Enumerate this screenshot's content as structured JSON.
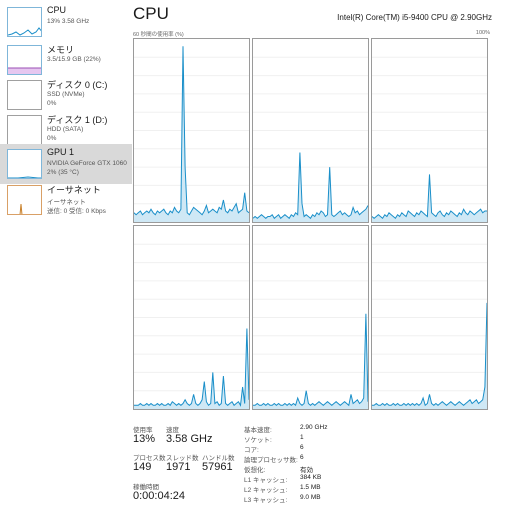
{
  "sidebar": {
    "items": [
      {
        "title": "CPU",
        "line1": "13%  3.58 GHz",
        "line2": ""
      },
      {
        "title": "メモリ",
        "line1": "3.5/15.9 GB (22%)",
        "line2": ""
      },
      {
        "title": "ディスク 0 (C:)",
        "line1": "SSD (NVMe)",
        "line2": "0%"
      },
      {
        "title": "ディスク 1 (D:)",
        "line1": "HDD (SATA)",
        "line2": "0%"
      },
      {
        "title": "GPU 1",
        "line1": "NVIDIA GeForce GTX 1060",
        "line2": "2% (35 °C)"
      },
      {
        "title": "イーサネット",
        "line1": "イーサネット",
        "line2": "送信: 0 受信: 0 Kbps"
      }
    ]
  },
  "main": {
    "title": "CPU",
    "model": "Intel(R) Core(TM) i5-9400 CPU @ 2.90GHz",
    "graph_caption_left": "60 秒間の使用率 (%)",
    "graph_caption_right": "100%"
  },
  "stats": {
    "usage_label": "使用率",
    "usage_value": "13%",
    "speed_label": "速度",
    "speed_value": "3.58 GHz",
    "processes_label": "プロセス数",
    "processes_value": "149",
    "threads_label": "スレッド数",
    "threads_value": "1971",
    "handles_label": "ハンドル数",
    "handles_value": "57961",
    "uptime_label": "稼働時間",
    "uptime_value": "0:00:04:24"
  },
  "specs": [
    {
      "key": "基本速度:",
      "value": "2.90 GHz"
    },
    {
      "key": "ソケット:",
      "value": "1"
    },
    {
      "key": "コア:",
      "value": "6"
    },
    {
      "key": "論理プロセッサ数:",
      "value": "6"
    },
    {
      "key": "仮想化:",
      "value": "有効"
    },
    {
      "key": "L1 キャッシュ:",
      "value": "384 KB"
    },
    {
      "key": "L2 キャッシュ:",
      "value": "1.5 MB"
    },
    {
      "key": "L3 キャッシュ:",
      "value": "9.0 MB"
    }
  ],
  "colors": {
    "graph_line": "#1a8fc9",
    "graph_fill": "#cfe8f5",
    "selected_bg": "#d9d9d9"
  },
  "core_graphs": [
    [
      5,
      4,
      5,
      6,
      4,
      5,
      6,
      5,
      7,
      5,
      4,
      6,
      5,
      6,
      7,
      5,
      4,
      6,
      5,
      8,
      6,
      5,
      7,
      96,
      30,
      5,
      4,
      6,
      8,
      7,
      6,
      5,
      4,
      6,
      9,
      5,
      6,
      7,
      6,
      5,
      8,
      7,
      12,
      6,
      5,
      7,
      6,
      8,
      10,
      5,
      6,
      7,
      16,
      6,
      5
    ],
    [
      2,
      3,
      2,
      3,
      4,
      3,
      2,
      3,
      3,
      4,
      2,
      3,
      4,
      2,
      3,
      4,
      3,
      2,
      4,
      3,
      5,
      4,
      38,
      10,
      3,
      4,
      3,
      2,
      4,
      3,
      5,
      4,
      6,
      5,
      3,
      4,
      30,
      4,
      3,
      4,
      5,
      6,
      4,
      5,
      4,
      3,
      4,
      8,
      5,
      6,
      4,
      5,
      6,
      7,
      9
    ],
    [
      3,
      2,
      3,
      4,
      3,
      2,
      4,
      3,
      5,
      4,
      3,
      2,
      4,
      3,
      5,
      4,
      3,
      6,
      5,
      4,
      3,
      5,
      4,
      6,
      5,
      4,
      3,
      26,
      5,
      4,
      3,
      5,
      6,
      4,
      3,
      5,
      4,
      6,
      5,
      4,
      3,
      5,
      4,
      7,
      5,
      4,
      6,
      5,
      4,
      5,
      6,
      7,
      5,
      6,
      6
    ],
    [
      2,
      2,
      2,
      3,
      2,
      2,
      3,
      2,
      3,
      2,
      2,
      3,
      2,
      3,
      2,
      2,
      3,
      2,
      4,
      3,
      2,
      3,
      2,
      3,
      5,
      3,
      2,
      3,
      8,
      3,
      2,
      3,
      5,
      15,
      4,
      2,
      3,
      20,
      3,
      4,
      2,
      3,
      18,
      3,
      2,
      3,
      4,
      2,
      3,
      4,
      2,
      12,
      3,
      44,
      5
    ],
    [
      2,
      2,
      3,
      2,
      2,
      3,
      2,
      3,
      2,
      2,
      3,
      2,
      3,
      2,
      2,
      3,
      2,
      3,
      2,
      3,
      2,
      6,
      3,
      2,
      3,
      10,
      3,
      2,
      3,
      2,
      3,
      4,
      3,
      2,
      3,
      4,
      3,
      2,
      3,
      4,
      3,
      2,
      3,
      4,
      3,
      2,
      8,
      3,
      4,
      5,
      3,
      4,
      6,
      52,
      4
    ],
    [
      2,
      2,
      3,
      2,
      2,
      3,
      2,
      3,
      2,
      2,
      3,
      2,
      3,
      2,
      2,
      3,
      2,
      3,
      2,
      3,
      2,
      3,
      2,
      3,
      6,
      2,
      3,
      8,
      3,
      2,
      3,
      2,
      3,
      4,
      3,
      2,
      3,
      4,
      3,
      2,
      3,
      4,
      3,
      2,
      3,
      4,
      5,
      3,
      4,
      5,
      3,
      4,
      5,
      12,
      58
    ]
  ]
}
